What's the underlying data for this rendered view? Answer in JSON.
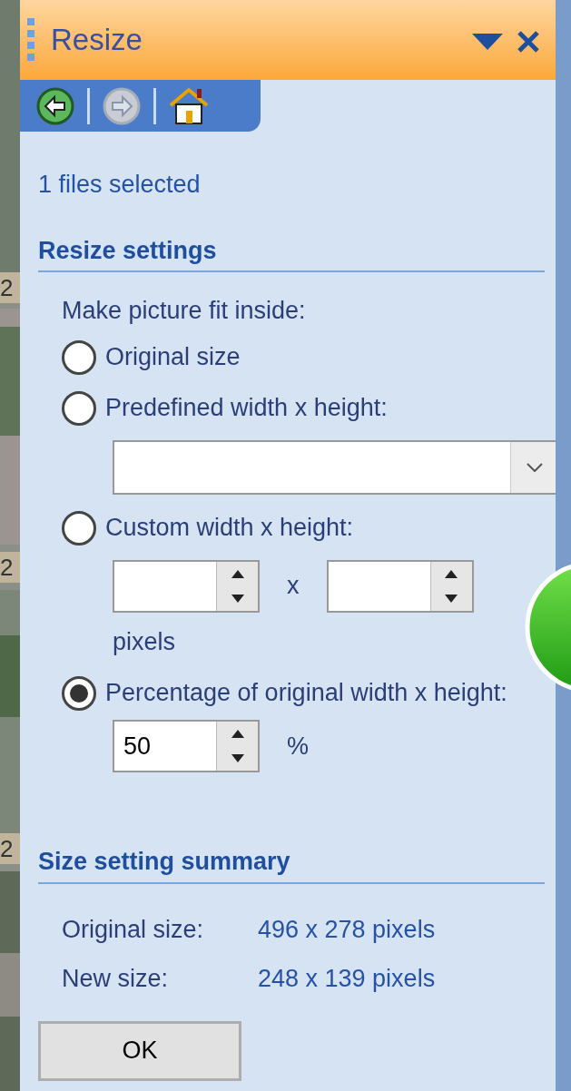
{
  "background": {
    "captions": [
      "2",
      "2",
      "2"
    ]
  },
  "window": {
    "title": "Resize"
  },
  "toolbar": [
    {
      "kind": "back",
      "disabled": false
    },
    {
      "kind": "forward",
      "disabled": true
    },
    {
      "kind": "home",
      "disabled": false
    }
  ],
  "selection_info": "1 files selected",
  "resize_settings": {
    "heading": "Resize settings",
    "prompt": "Make picture fit inside:",
    "options": [
      {
        "kind": "plain",
        "label": "Original size",
        "selected": false
      },
      {
        "kind": "dropdown",
        "label": "Predefined width x height:",
        "selected": false
      },
      {
        "kind": "custom",
        "label": "Custom width x height:",
        "selected": false,
        "separator": "x",
        "unit": "pixels"
      },
      {
        "kind": "percent",
        "label": "Percentage of original width x height:",
        "selected": true,
        "value": "50",
        "unit": "%"
      }
    ]
  },
  "summary": {
    "heading": "Size setting summary",
    "rows": [
      {
        "label": "Original size:",
        "value": "496 x 278 pixels"
      },
      {
        "label": "New size:",
        "value": "248 x 139 pixels"
      }
    ]
  },
  "buttons": [
    "OK"
  ]
}
